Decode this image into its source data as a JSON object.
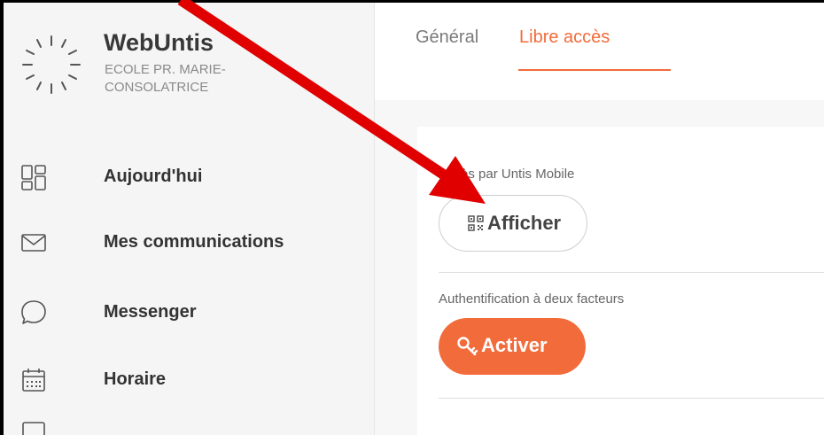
{
  "brand": {
    "title": "WebUntis",
    "subtitle": "ECOLE PR. MARIE-CONSOLATRICE"
  },
  "sidebar": {
    "items": [
      {
        "label": "Aujourd'hui",
        "icon": "dashboard-icon"
      },
      {
        "label": "Mes communications",
        "icon": "envelope-icon"
      },
      {
        "label": "Messenger",
        "icon": "chat-bubble-icon"
      },
      {
        "label": "Horaire",
        "icon": "calendar-icon"
      }
    ]
  },
  "tabs": [
    {
      "label": "Général",
      "active": false
    },
    {
      "label": "Libre accès",
      "active": true
    }
  ],
  "access": {
    "mobile_label": "Accès par Untis Mobile",
    "show_button": "Afficher",
    "twofa_label": "Authentification à deux facteurs",
    "activate_button": "Activer"
  },
  "colors": {
    "accent": "#f26b3a",
    "annotation_arrow": "#e00000"
  }
}
